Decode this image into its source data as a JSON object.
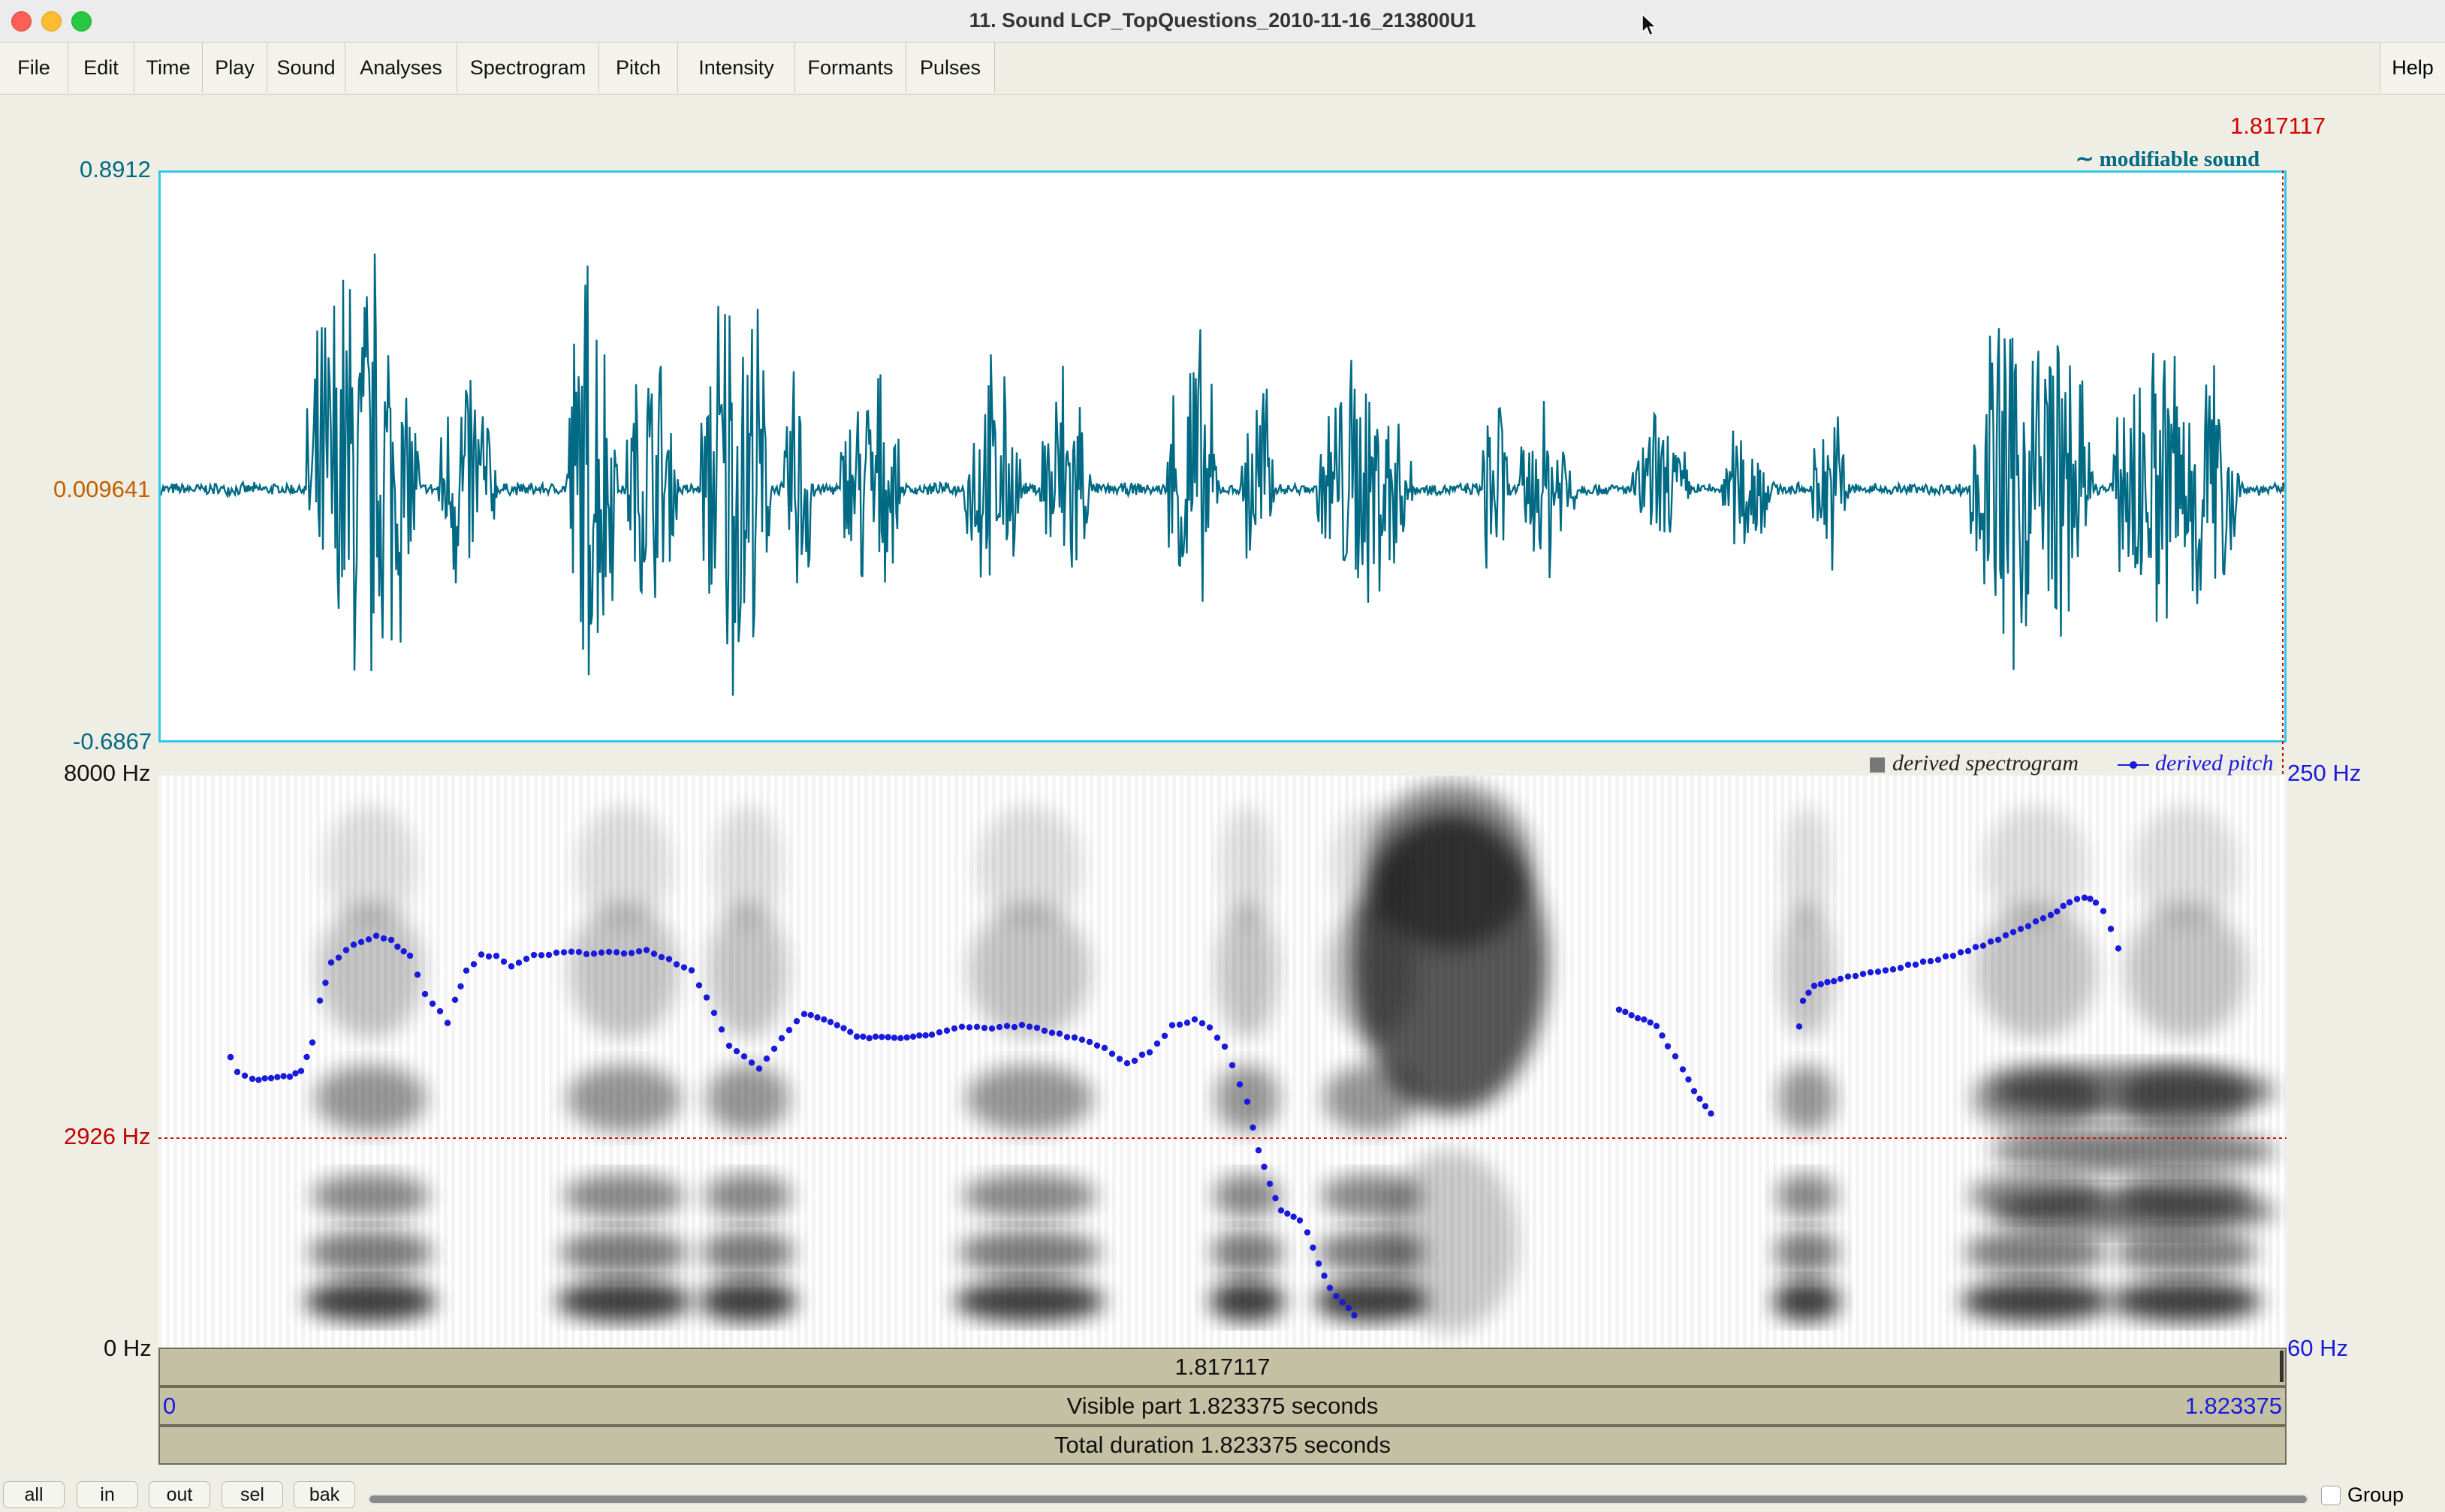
{
  "window": {
    "title": "11. Sound LCP_TopQuestions_2010-11-16_213800U1"
  },
  "menu": {
    "items": [
      "File",
      "Edit",
      "Time",
      "Play",
      "Sound",
      "Analyses",
      "Spectrogram",
      "Pitch",
      "Intensity",
      "Formants",
      "Pulses"
    ],
    "help": "Help"
  },
  "cursor": {
    "time": "1.817117"
  },
  "waveform": {
    "max": "0.8912",
    "center": "0.009641",
    "min": "-0.6867",
    "badge": "modifiable sound",
    "color": "#006a84"
  },
  "spectrogram": {
    "top_freq": "8000 Hz",
    "cursor_freq": "2926 Hz",
    "bottom_freq": "0 Hz",
    "legend_spectrogram": "derived spectrogram",
    "legend_pitch": "derived pitch",
    "pitch_top": "250 Hz",
    "pitch_bottom": "60 Hz"
  },
  "timebars": {
    "cursor": "1.817117",
    "visible_start": "0",
    "visible_part": "Visible part 1.823375 seconds",
    "visible_end": "1.823375",
    "total": "Total duration 1.823375 seconds"
  },
  "buttons": {
    "all": "all",
    "in": "in",
    "out": "out",
    "sel": "sel",
    "bak": "bak"
  },
  "group": {
    "label": "Group"
  },
  "colors": {
    "accent": "#32c8e8",
    "pitch": "#1a1adc",
    "cursor": "#cc1100"
  }
}
